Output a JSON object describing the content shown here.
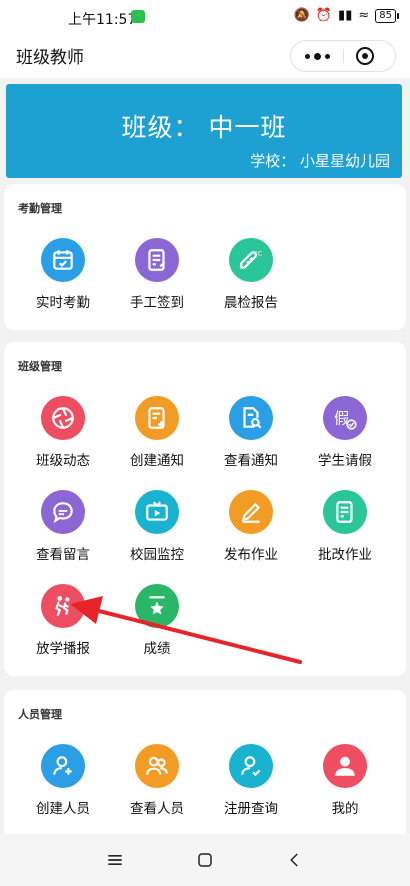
{
  "status_bar": {
    "time": "上午11:57",
    "battery": "85"
  },
  "nav": {
    "title": "班级教师"
  },
  "banner": {
    "class_label": "班级：  中一班",
    "school_label": "学校：  小星星幼儿园"
  },
  "attendance": {
    "title": "考勤管理",
    "items": [
      {
        "label": "实时考勤",
        "icon": "calendar-check-icon",
        "color": "#2b9fe6"
      },
      {
        "label": "手工签到",
        "icon": "checklist-edit-icon",
        "color": "#8b67d6"
      },
      {
        "label": "晨检报告",
        "icon": "thermometer-icon",
        "color": "#2bc59a"
      }
    ]
  },
  "class_mgmt": {
    "title": "班级管理",
    "items": [
      {
        "label": "班级动态",
        "icon": "aperture-icon",
        "color": "#ee4d62"
      },
      {
        "label": "创建通知",
        "icon": "doc-add-icon",
        "color": "#f39c25"
      },
      {
        "label": "查看通知",
        "icon": "doc-search-icon",
        "color": "#2b9fe6"
      },
      {
        "label": "学生请假",
        "icon": "leave-icon",
        "color": "#8b67d6"
      },
      {
        "label": "查看留言",
        "icon": "chat-icon",
        "color": "#8b67d6"
      },
      {
        "label": "校园监控",
        "icon": "tv-play-icon",
        "color": "#1ab3cf"
      },
      {
        "label": "发布作业",
        "icon": "pencil-icon",
        "color": "#f39c25"
      },
      {
        "label": "批改作业",
        "icon": "doc-edit-icon",
        "color": "#2bc59a"
      },
      {
        "label": "放学播报",
        "icon": "runner-icon",
        "color": "#ee4d62"
      },
      {
        "label": "成绩",
        "icon": "star-icon",
        "color": "#2bb566"
      }
    ]
  },
  "staff_mgmt": {
    "title": "人员管理",
    "items": [
      {
        "label": "创建人员",
        "icon": "user-add-icon",
        "color": "#2b9fe6"
      },
      {
        "label": "查看人员",
        "icon": "users-icon",
        "color": "#f39c25"
      },
      {
        "label": "注册查询",
        "icon": "user-check-icon",
        "color": "#1ab3cf"
      },
      {
        "label": "我的",
        "icon": "profile-icon",
        "color": "#ee4d62"
      }
    ]
  }
}
